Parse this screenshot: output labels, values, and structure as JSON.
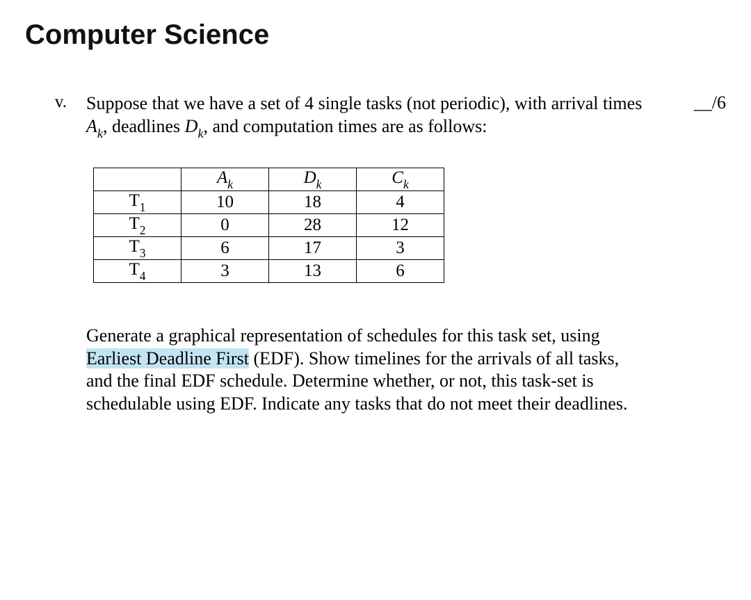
{
  "header": "Computer Science",
  "question": {
    "number": "v.",
    "points": "__/6",
    "intro_parts": {
      "p1": "Suppose that we have a set of 4 single tasks (not periodic), with arrival times ",
      "Ak": "A",
      "p2": ", deadlines ",
      "Dk": "D",
      "p3": ", and computation times  are as follows:",
      "k": "k"
    },
    "table": {
      "headers": {
        "Ak": "A",
        "Dk": "D",
        "Ck": "C",
        "k": "k"
      },
      "rows": [
        {
          "name": "T",
          "sub": "1",
          "A": "10",
          "D": "18",
          "C": "4"
        },
        {
          "name": "T",
          "sub": "2",
          "A": "0",
          "D": "28",
          "C": "12"
        },
        {
          "name": "T",
          "sub": "3",
          "A": "6",
          "D": "17",
          "C": "3"
        },
        {
          "name": "T",
          "sub": "4",
          "A": "3",
          "D": "13",
          "C": "6"
        }
      ]
    },
    "para2": {
      "p1": "Generate a graphical representation of schedules for this task set, using ",
      "highlight": "Earliest Deadline First",
      "p2": " (EDF). Show timelines for the arrivals of all tasks,",
      "p3": "and the final EDF schedule. Determine whether, or not, this task-set is schedulable using EDF. Indicate any tasks that do not meet their deadlines."
    }
  }
}
